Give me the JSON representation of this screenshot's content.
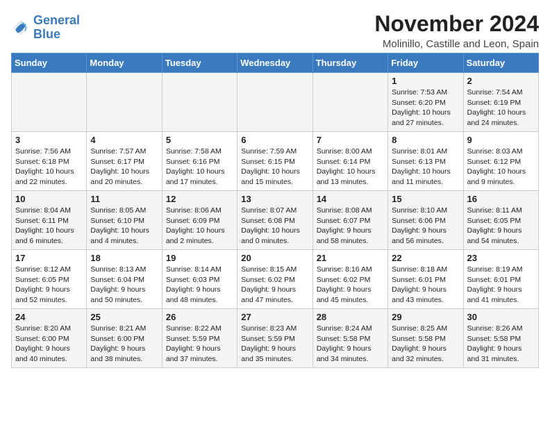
{
  "header": {
    "logo_line1": "General",
    "logo_line2": "Blue",
    "month_title": "November 2024",
    "location": "Molinillo, Castille and Leon, Spain"
  },
  "weekdays": [
    "Sunday",
    "Monday",
    "Tuesday",
    "Wednesday",
    "Thursday",
    "Friday",
    "Saturday"
  ],
  "weeks": [
    [
      {
        "day": "",
        "info": ""
      },
      {
        "day": "",
        "info": ""
      },
      {
        "day": "",
        "info": ""
      },
      {
        "day": "",
        "info": ""
      },
      {
        "day": "",
        "info": ""
      },
      {
        "day": "1",
        "info": "Sunrise: 7:53 AM\nSunset: 6:20 PM\nDaylight: 10 hours and 27 minutes."
      },
      {
        "day": "2",
        "info": "Sunrise: 7:54 AM\nSunset: 6:19 PM\nDaylight: 10 hours and 24 minutes."
      }
    ],
    [
      {
        "day": "3",
        "info": "Sunrise: 7:56 AM\nSunset: 6:18 PM\nDaylight: 10 hours and 22 minutes."
      },
      {
        "day": "4",
        "info": "Sunrise: 7:57 AM\nSunset: 6:17 PM\nDaylight: 10 hours and 20 minutes."
      },
      {
        "day": "5",
        "info": "Sunrise: 7:58 AM\nSunset: 6:16 PM\nDaylight: 10 hours and 17 minutes."
      },
      {
        "day": "6",
        "info": "Sunrise: 7:59 AM\nSunset: 6:15 PM\nDaylight: 10 hours and 15 minutes."
      },
      {
        "day": "7",
        "info": "Sunrise: 8:00 AM\nSunset: 6:14 PM\nDaylight: 10 hours and 13 minutes."
      },
      {
        "day": "8",
        "info": "Sunrise: 8:01 AM\nSunset: 6:13 PM\nDaylight: 10 hours and 11 minutes."
      },
      {
        "day": "9",
        "info": "Sunrise: 8:03 AM\nSunset: 6:12 PM\nDaylight: 10 hours and 9 minutes."
      }
    ],
    [
      {
        "day": "10",
        "info": "Sunrise: 8:04 AM\nSunset: 6:11 PM\nDaylight: 10 hours and 6 minutes."
      },
      {
        "day": "11",
        "info": "Sunrise: 8:05 AM\nSunset: 6:10 PM\nDaylight: 10 hours and 4 minutes."
      },
      {
        "day": "12",
        "info": "Sunrise: 8:06 AM\nSunset: 6:09 PM\nDaylight: 10 hours and 2 minutes."
      },
      {
        "day": "13",
        "info": "Sunrise: 8:07 AM\nSunset: 6:08 PM\nDaylight: 10 hours and 0 minutes."
      },
      {
        "day": "14",
        "info": "Sunrise: 8:08 AM\nSunset: 6:07 PM\nDaylight: 9 hours and 58 minutes."
      },
      {
        "day": "15",
        "info": "Sunrise: 8:10 AM\nSunset: 6:06 PM\nDaylight: 9 hours and 56 minutes."
      },
      {
        "day": "16",
        "info": "Sunrise: 8:11 AM\nSunset: 6:05 PM\nDaylight: 9 hours and 54 minutes."
      }
    ],
    [
      {
        "day": "17",
        "info": "Sunrise: 8:12 AM\nSunset: 6:05 PM\nDaylight: 9 hours and 52 minutes."
      },
      {
        "day": "18",
        "info": "Sunrise: 8:13 AM\nSunset: 6:04 PM\nDaylight: 9 hours and 50 minutes."
      },
      {
        "day": "19",
        "info": "Sunrise: 8:14 AM\nSunset: 6:03 PM\nDaylight: 9 hours and 48 minutes."
      },
      {
        "day": "20",
        "info": "Sunrise: 8:15 AM\nSunset: 6:02 PM\nDaylight: 9 hours and 47 minutes."
      },
      {
        "day": "21",
        "info": "Sunrise: 8:16 AM\nSunset: 6:02 PM\nDaylight: 9 hours and 45 minutes."
      },
      {
        "day": "22",
        "info": "Sunrise: 8:18 AM\nSunset: 6:01 PM\nDaylight: 9 hours and 43 minutes."
      },
      {
        "day": "23",
        "info": "Sunrise: 8:19 AM\nSunset: 6:01 PM\nDaylight: 9 hours and 41 minutes."
      }
    ],
    [
      {
        "day": "24",
        "info": "Sunrise: 8:20 AM\nSunset: 6:00 PM\nDaylight: 9 hours and 40 minutes."
      },
      {
        "day": "25",
        "info": "Sunrise: 8:21 AM\nSunset: 6:00 PM\nDaylight: 9 hours and 38 minutes."
      },
      {
        "day": "26",
        "info": "Sunrise: 8:22 AM\nSunset: 5:59 PM\nDaylight: 9 hours and 37 minutes."
      },
      {
        "day": "27",
        "info": "Sunrise: 8:23 AM\nSunset: 5:59 PM\nDaylight: 9 hours and 35 minutes."
      },
      {
        "day": "28",
        "info": "Sunrise: 8:24 AM\nSunset: 5:58 PM\nDaylight: 9 hours and 34 minutes."
      },
      {
        "day": "29",
        "info": "Sunrise: 8:25 AM\nSunset: 5:58 PM\nDaylight: 9 hours and 32 minutes."
      },
      {
        "day": "30",
        "info": "Sunrise: 8:26 AM\nSunset: 5:58 PM\nDaylight: 9 hours and 31 minutes."
      }
    ]
  ]
}
